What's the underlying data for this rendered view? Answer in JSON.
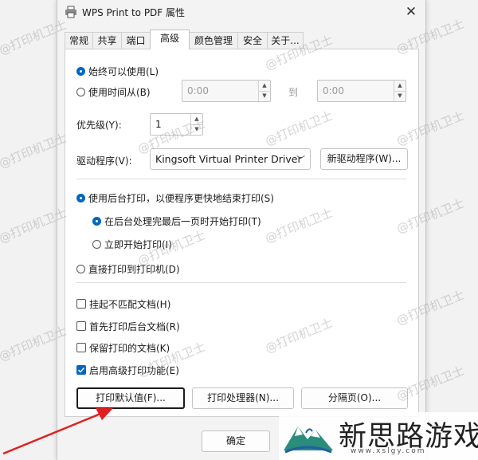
{
  "window": {
    "title": "WPS Print to PDF 属性",
    "close": "✕"
  },
  "tabs": [
    {
      "label": "常规"
    },
    {
      "label": "共享"
    },
    {
      "label": "端口"
    },
    {
      "label": "高级"
    },
    {
      "label": "颜色管理"
    },
    {
      "label": "安全"
    },
    {
      "label": "关于..."
    }
  ],
  "availability": {
    "always": "始终可以使用(L)",
    "from": "使用时间从(B)",
    "from_time": "0:00",
    "to_label": "到",
    "to_time": "0:00"
  },
  "priority": {
    "label": "优先级(Y):",
    "value": "1"
  },
  "driver": {
    "label": "驱动程序(V):",
    "selected": "Kingsoft Virtual Printer Driver",
    "new_button": "新驱动程序(W)..."
  },
  "spool": {
    "spool_option": "使用后台打印，以便程序更快地结束打印(S)",
    "after_last_page": "在后台处理完最后一页时开始打印(T)",
    "immediately": "立即开始打印(I)",
    "direct": "直接打印到打印机(D)"
  },
  "options": {
    "hold_mismatched": "挂起不匹配文档(H)",
    "spooled_first": "首先打印后台文档(R)",
    "keep_printed": "保留打印的文档(K)",
    "advanced_features": "启用高级打印功能(E)"
  },
  "buttons": {
    "defaults": "打印默认值(F)...",
    "processor": "打印处理器(N)...",
    "separator": "分隔页(O)...",
    "ok": "确定"
  },
  "watermark": "@打印机卫士",
  "logo": {
    "text": "新思路游戏",
    "url": "www.xslgy.com"
  },
  "colors": {
    "accent": "#0067c0",
    "arrow": "#e02020"
  }
}
